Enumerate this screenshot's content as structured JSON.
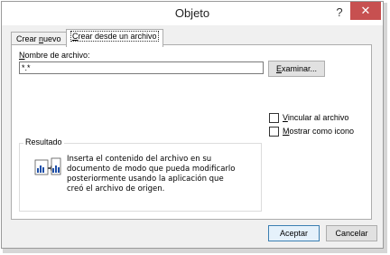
{
  "window": {
    "title": "Objeto",
    "help_glyph": "?",
    "close_glyph": "✕"
  },
  "tabs": [
    {
      "pre": "Crear ",
      "accel": "n",
      "post": "uevo",
      "active": false
    },
    {
      "pre": "",
      "accel": "C",
      "post": "rear desde un archivo",
      "active": true
    }
  ],
  "file": {
    "label_pre": "",
    "label_accel": "N",
    "label_post": "ombre de archivo:",
    "value": "*.*"
  },
  "browse_button": {
    "pre": "",
    "accel": "E",
    "post": "xaminar..."
  },
  "options": {
    "link": {
      "pre": "",
      "accel": "V",
      "post": "incular al archivo",
      "checked": false
    },
    "icon": {
      "pre": "",
      "accel": "M",
      "post": "ostrar como icono",
      "checked": false
    }
  },
  "result": {
    "title": "Resultado",
    "lines": [
      "Inserta el contenido del archivo en su",
      "documento de modo que pueda modificarlo",
      "posteriormente usando la aplicación que",
      "creó el archivo de origen."
    ]
  },
  "buttons": {
    "ok": "Aceptar",
    "cancel": "Cancelar"
  },
  "colors": {
    "close_bg": "#c75050",
    "default_border": "#3c7fb1"
  }
}
